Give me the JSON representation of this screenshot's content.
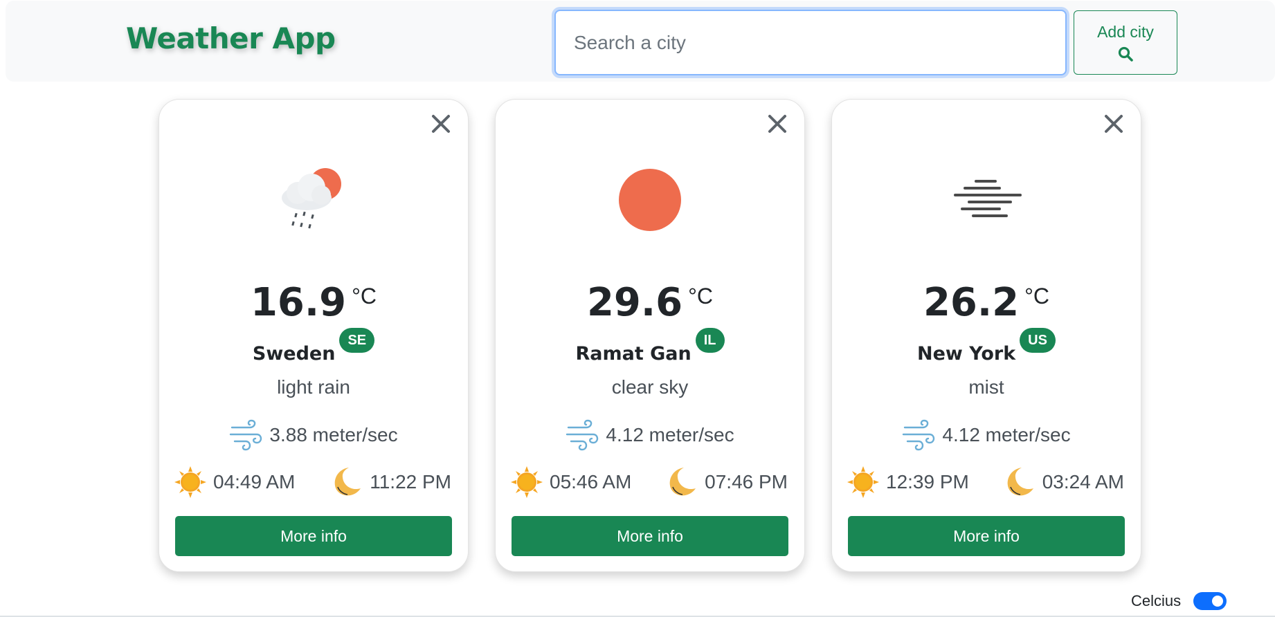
{
  "app": {
    "title": "Weather App"
  },
  "search": {
    "placeholder": "Search a city",
    "value": ""
  },
  "add_button": {
    "label": "Add city",
    "icon": "search-icon"
  },
  "cards": [
    {
      "temperature": "16.9",
      "unit": "°C",
      "city": "Sweden",
      "country_code": "SE",
      "description": "light rain",
      "wind": "3.88 meter/sec",
      "sunrise": "04:49 AM",
      "sunset": "11:22 PM",
      "weather_icon": "light-rain-icon",
      "button_label": "More info"
    },
    {
      "temperature": "29.6",
      "unit": "°C",
      "city": "Ramat Gan",
      "country_code": "IL",
      "description": "clear sky",
      "wind": "4.12 meter/sec",
      "sunrise": "05:46 AM",
      "sunset": "07:46 PM",
      "weather_icon": "clear-sky-icon",
      "button_label": "More info"
    },
    {
      "temperature": "26.2",
      "unit": "°C",
      "city": "New York",
      "country_code": "US",
      "description": "mist",
      "wind": "4.12 meter/sec",
      "sunrise": "12:39 PM",
      "sunset": "03:24 AM",
      "weather_icon": "mist-icon",
      "button_label": "More info"
    }
  ],
  "unit_toggle": {
    "label": "Celcius",
    "checked": true
  },
  "colors": {
    "brand": "#198754",
    "accent": "#0d6efd",
    "sun": "#f5a623",
    "moon": "#f2b84b",
    "wind": "#6aaed6"
  }
}
